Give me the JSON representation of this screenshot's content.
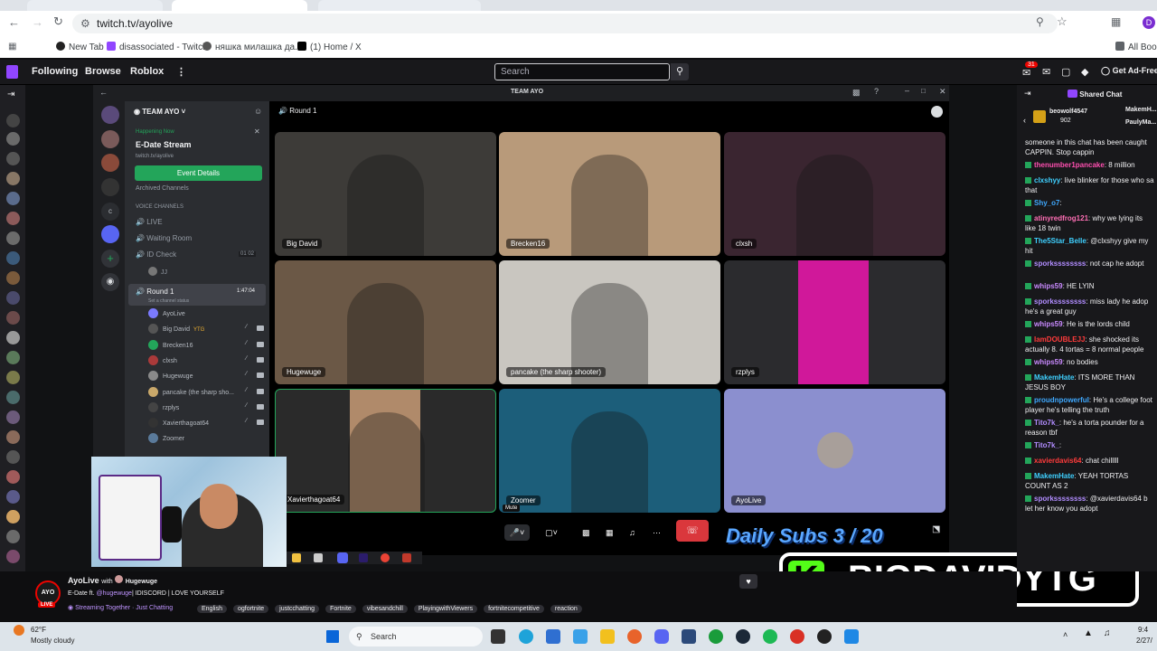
{
  "browser": {
    "url": "twitch.tv/ayolive",
    "bookmarks": [
      "New Tab",
      "disassociated - Twitch",
      "няшка милашка да...",
      "(1) Home / X",
      "All Book"
    ],
    "profile_initial": "D"
  },
  "twitch_nav": {
    "following": "Following",
    "browse": "Browse",
    "roblox": "Roblox",
    "search_placeholder": "Search",
    "notif_count": "31",
    "ad_free": "Get Ad-Free"
  },
  "discord": {
    "window_title": "TEAM AYO",
    "server_name": "TEAM AYO",
    "happening_now": "Happening Now",
    "event_title": "E-Date Stream",
    "event_link": "twitch.tv/ayolive",
    "event_button": "Event Details",
    "archived": "Archived Channels",
    "voice_header": "VOICE CHANNELS",
    "channels": [
      "LIVE",
      "Waiting Room",
      "ID Check"
    ],
    "id_check_counts": "01   02",
    "id_check_user": "JJ",
    "round_channel": "Round 1",
    "round_time": "1:47:04",
    "round_status": "Set a channel status",
    "members": [
      "AyoLive",
      "Big David",
      "Brecken16",
      "clxsh",
      "Hugewuge",
      "pancake (the sharp sho...",
      "rzplys",
      "Xavierthagoat64",
      "Zoomer"
    ],
    "big_david_tag": "YTG",
    "call_header": "Round 1",
    "tiles": [
      {
        "name": "Big David",
        "color": "#3d3b38"
      },
      {
        "name": "Brecken16",
        "color": "#b89a7a"
      },
      {
        "name": "clxsh",
        "color": "#3a2530"
      },
      {
        "name": "Hugewuge",
        "color": "#6b5846"
      },
      {
        "name": "pancake (the sharp shooter)",
        "color": "#c9c6c0"
      },
      {
        "name": "rzplys",
        "color": "#2b2b2e"
      },
      {
        "name": "Xavierthagoat64",
        "color": "#2a2a2a"
      },
      {
        "name": "Zoomer",
        "color": "#1c5e7a"
      },
      {
        "name": "AyoLive",
        "color": "#8b8fcf"
      }
    ],
    "mute_tooltip": "Mute"
  },
  "overlay": {
    "daily_subs": "Daily Subs 3 / 20",
    "kick_name": "BIGDAVIDYTG",
    "kick_letter": "K"
  },
  "chat": {
    "title": "Shared Chat",
    "top_gifters": [
      "beowolf4547",
      "902",
      "MakemH...",
      "PaulyMa..."
    ],
    "messages": [
      {
        "user": "",
        "text": "someone in this chat has been caught CAPPIN. Stop cappin",
        "color": "#efeff1"
      },
      {
        "user": "thenumber1pancake",
        "text": ": 8 million",
        "color": "#ff4fb0"
      },
      {
        "user": "clxshyy",
        "text": ": live blinker for those who sa that",
        "color": "#3fd0ff"
      },
      {
        "user": "Shy_o7",
        "text": ":",
        "color": "#3fa9ff"
      },
      {
        "user": "atinyredfrog121",
        "text": ": why we lying its like 18 twin",
        "color": "#ff6fb5"
      },
      {
        "user": "The5Star_Belle",
        "text": ": @clxshyy give my hit",
        "color": "#3fd0ff"
      },
      {
        "user": "sporkssssssss",
        "text": ": not cap he adopt",
        "color": "#b18cff"
      },
      {
        "user": "whips59",
        "text": ": HE LYIN",
        "color": "#c98aff"
      },
      {
        "user": "sporkssssssss",
        "text": ": miss lady he adop he's a great guy",
        "color": "#b18cff"
      },
      {
        "user": "whips59",
        "text": ": He is the lords child",
        "color": "#c98aff"
      },
      {
        "user": "IamDOUBLEJJ",
        "text": ": she shocked its actually 8. 4 tortas = 8 normal people",
        "color": "#ff3b3b"
      },
      {
        "user": "whips59",
        "text": ": no bodies",
        "color": "#c98aff"
      },
      {
        "user": "MakemHate",
        "text": ": ITS MORE THAN JESUS BOY",
        "color": "#3fd0ff"
      },
      {
        "user": "proudnpowerful",
        "text": ": He's a college foot player he's telling the truth",
        "color": "#3fa9ff"
      },
      {
        "user": "Tito7k_",
        "text": ": he's a torta pounder for a reason tbf",
        "color": "#b18cff"
      },
      {
        "user": "Tito7k_",
        "text": ":",
        "color": "#b18cff"
      },
      {
        "user": "xavierdavis64",
        "text": ": chat chilllll",
        "color": "#ff3b3b"
      },
      {
        "user": "MakemHate",
        "text": ": YEAH TORTAS COUNT AS 2",
        "color": "#3fd0ff"
      },
      {
        "user": "sporkssssssss",
        "text": ": @xavierdavis64 b let her know you adopt",
        "color": "#b18cff"
      }
    ]
  },
  "stream_info": {
    "channel": "AyoLive",
    "with": "with",
    "collab": "Hugewuge",
    "live_badge": "LIVE",
    "title_prefix": "E-Date ft.",
    "title_mention": "@hugewuge",
    "title_rest": "| IDISCORD | LOVE YOURSELF",
    "streaming_together": "Streaming Together",
    "category": "Just Chatting",
    "tags": [
      "English",
      "ogfortnite",
      "justcchatting",
      "Fortnite",
      "vibesandchill",
      "PlayingwithViewers",
      "fortnitecompetitive",
      "reaction"
    ]
  },
  "taskbar": {
    "temp": "62°F",
    "weather": "Mostly cloudy",
    "search": "Search",
    "time": "9:4",
    "date": "2/27/"
  }
}
